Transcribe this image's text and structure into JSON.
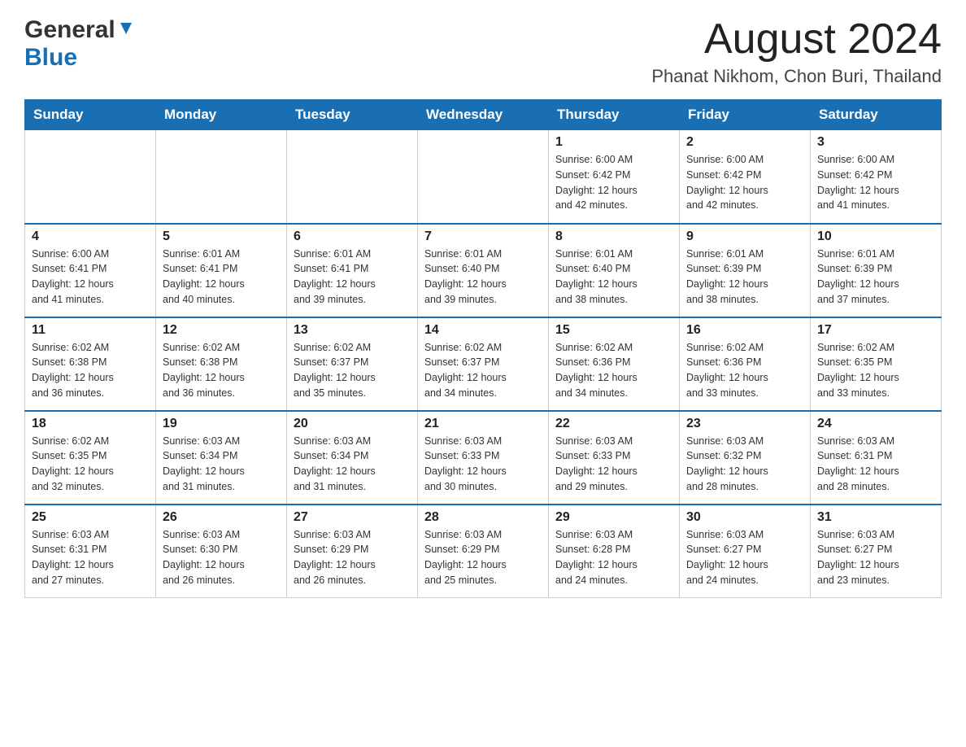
{
  "header": {
    "logo_general": "General",
    "logo_blue": "Blue",
    "month_title": "August 2024",
    "subtitle": "Phanat Nikhom, Chon Buri, Thailand"
  },
  "weekdays": [
    "Sunday",
    "Monday",
    "Tuesday",
    "Wednesday",
    "Thursday",
    "Friday",
    "Saturday"
  ],
  "weeks": [
    [
      {
        "day": "",
        "info": ""
      },
      {
        "day": "",
        "info": ""
      },
      {
        "day": "",
        "info": ""
      },
      {
        "day": "",
        "info": ""
      },
      {
        "day": "1",
        "info": "Sunrise: 6:00 AM\nSunset: 6:42 PM\nDaylight: 12 hours\nand 42 minutes."
      },
      {
        "day": "2",
        "info": "Sunrise: 6:00 AM\nSunset: 6:42 PM\nDaylight: 12 hours\nand 42 minutes."
      },
      {
        "day": "3",
        "info": "Sunrise: 6:00 AM\nSunset: 6:42 PM\nDaylight: 12 hours\nand 41 minutes."
      }
    ],
    [
      {
        "day": "4",
        "info": "Sunrise: 6:00 AM\nSunset: 6:41 PM\nDaylight: 12 hours\nand 41 minutes."
      },
      {
        "day": "5",
        "info": "Sunrise: 6:01 AM\nSunset: 6:41 PM\nDaylight: 12 hours\nand 40 minutes."
      },
      {
        "day": "6",
        "info": "Sunrise: 6:01 AM\nSunset: 6:41 PM\nDaylight: 12 hours\nand 39 minutes."
      },
      {
        "day": "7",
        "info": "Sunrise: 6:01 AM\nSunset: 6:40 PM\nDaylight: 12 hours\nand 39 minutes."
      },
      {
        "day": "8",
        "info": "Sunrise: 6:01 AM\nSunset: 6:40 PM\nDaylight: 12 hours\nand 38 minutes."
      },
      {
        "day": "9",
        "info": "Sunrise: 6:01 AM\nSunset: 6:39 PM\nDaylight: 12 hours\nand 38 minutes."
      },
      {
        "day": "10",
        "info": "Sunrise: 6:01 AM\nSunset: 6:39 PM\nDaylight: 12 hours\nand 37 minutes."
      }
    ],
    [
      {
        "day": "11",
        "info": "Sunrise: 6:02 AM\nSunset: 6:38 PM\nDaylight: 12 hours\nand 36 minutes."
      },
      {
        "day": "12",
        "info": "Sunrise: 6:02 AM\nSunset: 6:38 PM\nDaylight: 12 hours\nand 36 minutes."
      },
      {
        "day": "13",
        "info": "Sunrise: 6:02 AM\nSunset: 6:37 PM\nDaylight: 12 hours\nand 35 minutes."
      },
      {
        "day": "14",
        "info": "Sunrise: 6:02 AM\nSunset: 6:37 PM\nDaylight: 12 hours\nand 34 minutes."
      },
      {
        "day": "15",
        "info": "Sunrise: 6:02 AM\nSunset: 6:36 PM\nDaylight: 12 hours\nand 34 minutes."
      },
      {
        "day": "16",
        "info": "Sunrise: 6:02 AM\nSunset: 6:36 PM\nDaylight: 12 hours\nand 33 minutes."
      },
      {
        "day": "17",
        "info": "Sunrise: 6:02 AM\nSunset: 6:35 PM\nDaylight: 12 hours\nand 33 minutes."
      }
    ],
    [
      {
        "day": "18",
        "info": "Sunrise: 6:02 AM\nSunset: 6:35 PM\nDaylight: 12 hours\nand 32 minutes."
      },
      {
        "day": "19",
        "info": "Sunrise: 6:03 AM\nSunset: 6:34 PM\nDaylight: 12 hours\nand 31 minutes."
      },
      {
        "day": "20",
        "info": "Sunrise: 6:03 AM\nSunset: 6:34 PM\nDaylight: 12 hours\nand 31 minutes."
      },
      {
        "day": "21",
        "info": "Sunrise: 6:03 AM\nSunset: 6:33 PM\nDaylight: 12 hours\nand 30 minutes."
      },
      {
        "day": "22",
        "info": "Sunrise: 6:03 AM\nSunset: 6:33 PM\nDaylight: 12 hours\nand 29 minutes."
      },
      {
        "day": "23",
        "info": "Sunrise: 6:03 AM\nSunset: 6:32 PM\nDaylight: 12 hours\nand 28 minutes."
      },
      {
        "day": "24",
        "info": "Sunrise: 6:03 AM\nSunset: 6:31 PM\nDaylight: 12 hours\nand 28 minutes."
      }
    ],
    [
      {
        "day": "25",
        "info": "Sunrise: 6:03 AM\nSunset: 6:31 PM\nDaylight: 12 hours\nand 27 minutes."
      },
      {
        "day": "26",
        "info": "Sunrise: 6:03 AM\nSunset: 6:30 PM\nDaylight: 12 hours\nand 26 minutes."
      },
      {
        "day": "27",
        "info": "Sunrise: 6:03 AM\nSunset: 6:29 PM\nDaylight: 12 hours\nand 26 minutes."
      },
      {
        "day": "28",
        "info": "Sunrise: 6:03 AM\nSunset: 6:29 PM\nDaylight: 12 hours\nand 25 minutes."
      },
      {
        "day": "29",
        "info": "Sunrise: 6:03 AM\nSunset: 6:28 PM\nDaylight: 12 hours\nand 24 minutes."
      },
      {
        "day": "30",
        "info": "Sunrise: 6:03 AM\nSunset: 6:27 PM\nDaylight: 12 hours\nand 24 minutes."
      },
      {
        "day": "31",
        "info": "Sunrise: 6:03 AM\nSunset: 6:27 PM\nDaylight: 12 hours\nand 23 minutes."
      }
    ]
  ]
}
